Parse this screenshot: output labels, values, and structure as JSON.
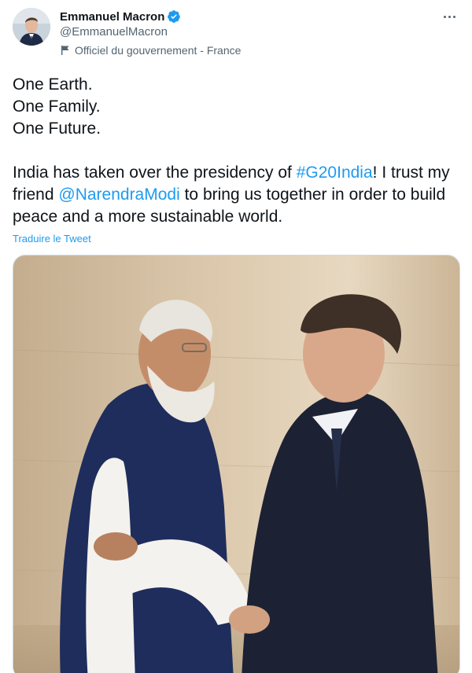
{
  "author": {
    "display_name": "Emmanuel Macron",
    "handle": "@EmmanuelMacron",
    "label": "Officiel du gouvernement - France",
    "verified": true
  },
  "tweet": {
    "lines": [
      "One Earth.",
      "One Family.",
      "One Future."
    ],
    "para_part1": "India has taken over the presidency of ",
    "hashtag": "#G20India",
    "para_part2": "! I trust my friend ",
    "mention": "@NarendraModi",
    "para_part3": " to bring us together in order to build peace and a more sustainable world.",
    "translate_label": "Traduire le Tweet"
  },
  "colors": {
    "link": "#1d9bf0",
    "verified": "#1d9bf0",
    "secondary_text": "#536471"
  },
  "icons": [
    "verified-badge-icon",
    "government-flag-icon",
    "more-options-icon"
  ]
}
